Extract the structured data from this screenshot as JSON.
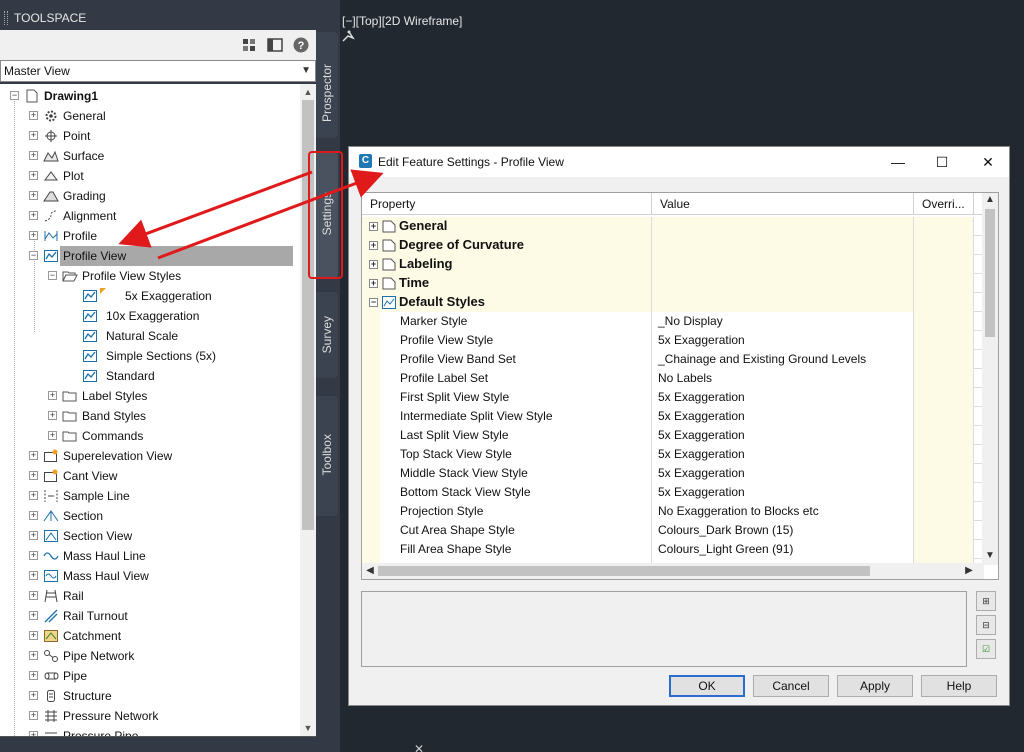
{
  "toolspace": {
    "title": "TOOLSPACE",
    "view_selector": "Master View",
    "tree": [
      {
        "label": "Drawing1",
        "level": 0,
        "bold": true,
        "exp": "−",
        "icon": "drawing-icon"
      },
      {
        "label": "General",
        "level": 1,
        "exp": "+",
        "icon": "gear-icon"
      },
      {
        "label": "Point",
        "level": 1,
        "exp": "+",
        "icon": "point-icon"
      },
      {
        "label": "Surface",
        "level": 1,
        "exp": "+",
        "icon": "surface-icon"
      },
      {
        "label": "Plot",
        "level": 1,
        "exp": "+",
        "icon": "plot-icon"
      },
      {
        "label": "Grading",
        "level": 1,
        "exp": "+",
        "icon": "grading-icon"
      },
      {
        "label": "Alignment",
        "level": 1,
        "exp": "+",
        "icon": "alignment-icon"
      },
      {
        "label": "Profile",
        "level": 1,
        "exp": "+",
        "icon": "profile-icon"
      },
      {
        "label": "Profile View",
        "level": 1,
        "exp": "−",
        "icon": "profile-view-icon",
        "selected": true
      },
      {
        "label": "Profile View Styles",
        "level": 2,
        "exp": "−",
        "icon": "folder-open-icon"
      },
      {
        "label": "5x Exaggeration",
        "level": 3,
        "icon": "profile-view-style-icon",
        "current": true
      },
      {
        "label": "10x Exaggeration",
        "level": 3,
        "icon": "profile-view-style-icon"
      },
      {
        "label": "Natural Scale",
        "level": 3,
        "icon": "profile-view-style-icon"
      },
      {
        "label": "Simple Sections (5x)",
        "level": 3,
        "icon": "profile-view-style-icon"
      },
      {
        "label": "Standard",
        "level": 3,
        "icon": "profile-view-style-icon"
      },
      {
        "label": "Label Styles",
        "level": 2,
        "exp": "+",
        "icon": "folder-icon"
      },
      {
        "label": "Band Styles",
        "level": 2,
        "exp": "+",
        "icon": "folder-icon"
      },
      {
        "label": "Commands",
        "level": 2,
        "exp": "+",
        "icon": "folder-icon"
      },
      {
        "label": "Superelevation View",
        "level": 1,
        "exp": "+",
        "icon": "superelevation-icon"
      },
      {
        "label": "Cant View",
        "level": 1,
        "exp": "+",
        "icon": "cant-icon"
      },
      {
        "label": "Sample Line",
        "level": 1,
        "exp": "+",
        "icon": "sample-line-icon"
      },
      {
        "label": "Section",
        "level": 1,
        "exp": "+",
        "icon": "section-icon"
      },
      {
        "label": "Section View",
        "level": 1,
        "exp": "+",
        "icon": "section-view-icon"
      },
      {
        "label": "Mass Haul Line",
        "level": 1,
        "exp": "+",
        "icon": "mass-haul-line-icon"
      },
      {
        "label": "Mass Haul View",
        "level": 1,
        "exp": "+",
        "icon": "mass-haul-view-icon"
      },
      {
        "label": "Rail",
        "level": 1,
        "exp": "+",
        "icon": "rail-icon"
      },
      {
        "label": "Rail Turnout",
        "level": 1,
        "exp": "+",
        "icon": "rail-turnout-icon"
      },
      {
        "label": "Catchment",
        "level": 1,
        "exp": "+",
        "icon": "catchment-icon"
      },
      {
        "label": "Pipe Network",
        "level": 1,
        "exp": "+",
        "icon": "pipe-network-icon"
      },
      {
        "label": "Pipe",
        "level": 1,
        "exp": "+",
        "icon": "pipe-icon"
      },
      {
        "label": "Structure",
        "level": 1,
        "exp": "+",
        "icon": "structure-icon"
      },
      {
        "label": "Pressure Network",
        "level": 1,
        "exp": "+",
        "icon": "pressure-network-icon"
      },
      {
        "label": "Pressure Pipe",
        "level": 1,
        "exp": "+",
        "icon": "pressure-pipe-icon"
      }
    ],
    "tabs": {
      "prospector": "Prospector",
      "settings": "Settings",
      "survey": "Survey",
      "toolbox": "Toolbox"
    }
  },
  "viewport": {
    "label": "[−][Top][2D Wireframe]"
  },
  "dialog": {
    "title": "Edit Feature Settings - Profile View",
    "columns": {
      "property": "Property",
      "value": "Value",
      "override": "Overri..."
    },
    "categories": [
      {
        "label": "General",
        "exp": "+"
      },
      {
        "label": "Degree of Curvature",
        "exp": "+"
      },
      {
        "label": "Labeling",
        "exp": "+"
      },
      {
        "label": "Time",
        "exp": "+"
      },
      {
        "label": "Default Styles",
        "exp": "−"
      }
    ],
    "rows": [
      {
        "property": "Marker Style",
        "value": "_No Display"
      },
      {
        "property": "Profile View Style",
        "value": "5x Exaggeration"
      },
      {
        "property": "Profile View Band Set",
        "value": "_Chainage and Existing Ground Levels"
      },
      {
        "property": "Profile Label Set",
        "value": "No Labels"
      },
      {
        "property": "First Split View Style",
        "value": "5x Exaggeration"
      },
      {
        "property": "Intermediate Split View Style",
        "value": "5x Exaggeration"
      },
      {
        "property": "Last Split View Style",
        "value": "5x Exaggeration"
      },
      {
        "property": "Top Stack View Style",
        "value": "5x Exaggeration"
      },
      {
        "property": "Middle Stack View Style",
        "value": "5x Exaggeration"
      },
      {
        "property": "Bottom Stack View Style",
        "value": "5x Exaggeration"
      },
      {
        "property": "Projection Style",
        "value": "No Exaggeration to Blocks etc"
      },
      {
        "property": "Cut Area Shape Style",
        "value": "Colours_Dark Brown (15)"
      },
      {
        "property": "Fill Area Shape Style",
        "value": "Colours_Light Green (91)"
      }
    ],
    "buttons": {
      "ok": "OK",
      "cancel": "Cancel",
      "apply": "Apply",
      "help": "Help"
    }
  },
  "colors": {
    "annotation": "#e01a1a",
    "accent": "#2b6cd0",
    "category_bg": "#fdfbe6"
  }
}
